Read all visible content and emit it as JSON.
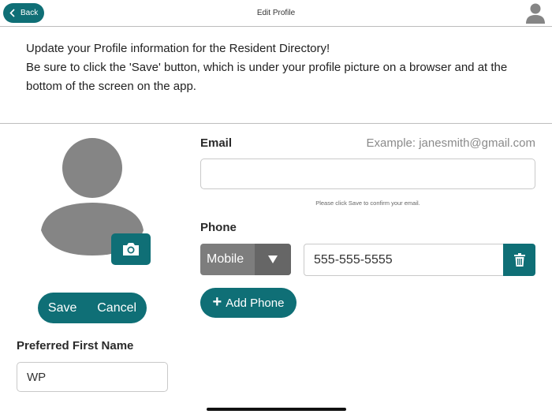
{
  "header": {
    "back_label": "Back",
    "title": "Edit Profile",
    "avatar_icon": "user-avatar-icon"
  },
  "intro": {
    "line1": "Update your Profile information for the Resident Directory!",
    "line2": "Be sure to click the 'Save' button, which is under your profile picture on a browser and at the bottom of the screen on the app."
  },
  "profile": {
    "photo_icon": "user-silhouette-icon",
    "camera_icon": "camera-icon",
    "save_label": "Save",
    "cancel_label": "Cancel"
  },
  "first_name": {
    "label": "Preferred First Name",
    "value": "WP"
  },
  "email": {
    "label": "Email",
    "example": "Example: janesmith@gmail.com",
    "value": "",
    "hint": "Please click Save to confirm your email."
  },
  "phone": {
    "label": "Phone",
    "type": "Mobile",
    "number": "555-555-5555",
    "add_label": "Add Phone",
    "delete_icon": "trash-icon"
  },
  "colors": {
    "accent": "#0f6f76",
    "select_bg": "#7d7d7d",
    "avatar_gray": "#858585"
  }
}
